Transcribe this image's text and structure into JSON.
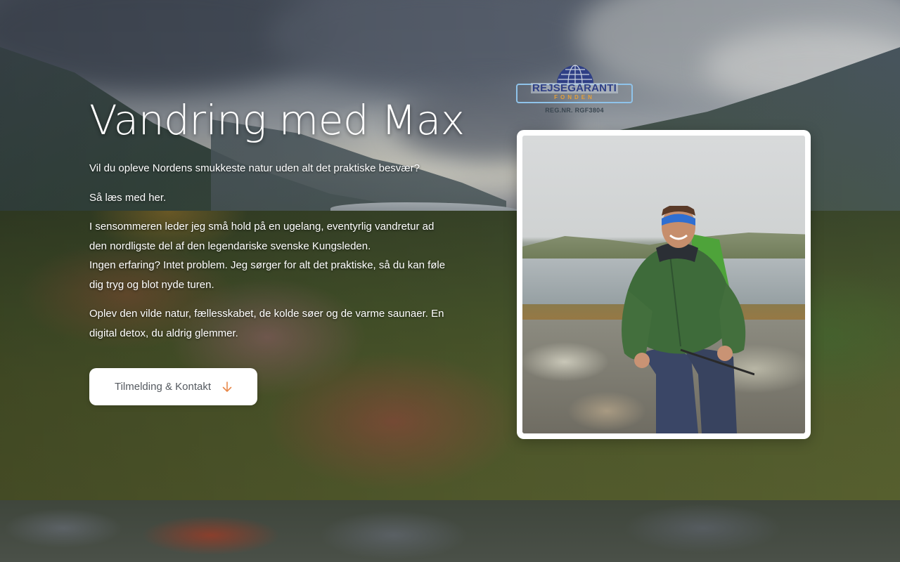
{
  "hero": {
    "title": "Vandring med Max",
    "intro": {
      "p1": "Vil du opleve Nordens smukkeste natur uden alt det praktiske besvær?",
      "p2": "Så læs med her.",
      "p3_l1": "I sensommeren leder jeg små hold på en ugelang, eventyrlig vandretur ad",
      "p3_l2": "den nordligste del af den legendariske svenske Kungsleden.",
      "p3_l3": "Ingen erfaring? Intet problem. Jeg sørger for alt det praktiske, så du kan føle",
      "p3_l4": "dig tryg og blot nyde turen.",
      "p4_l1": "Oplev den vilde natur, fællesskabet, de kolde søer og de varme saunaer. En",
      "p4_l2": "digital detox, du aldrig glemmer."
    },
    "cta": {
      "label": "Tilmelding & Kontakt",
      "icon": "arrow-down-icon"
    }
  },
  "logo": {
    "name": "REJSEGARANTI",
    "sub": "FONDEN",
    "reg": "REG.NR. RGF3804",
    "icon": "globe-icon"
  },
  "photo": {
    "alt": "hiker-portrait"
  },
  "colors": {
    "accent": "#e8884a",
    "text_light": "#ffffff",
    "button_text": "#555a60",
    "logo_blue": "#2f3f85",
    "logo_orange": "#e5a03a"
  }
}
